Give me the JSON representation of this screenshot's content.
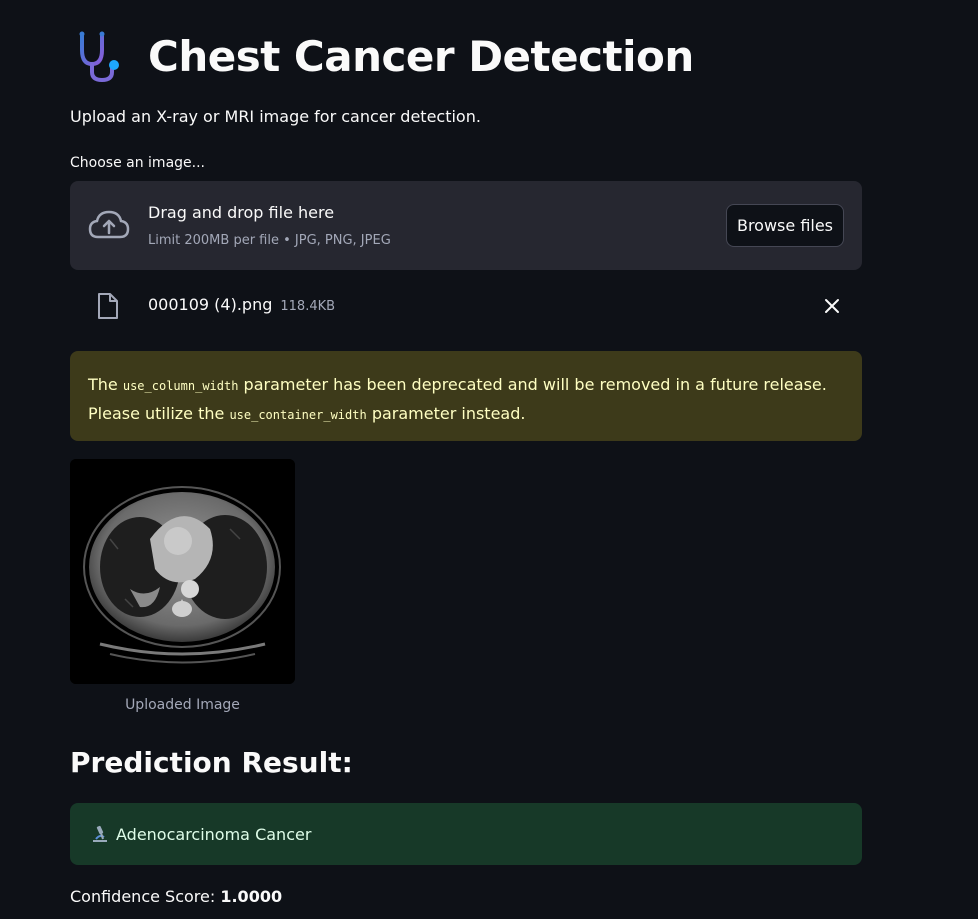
{
  "header": {
    "title": "Chest Cancer Detection",
    "icon": "stethoscope-icon",
    "subtitle": "Upload an X-ray or MRI image for cancer detection."
  },
  "uploader": {
    "label": "Choose an image...",
    "drop_text": "Drag and drop file here",
    "limit_text": "Limit 200MB per file • JPG, PNG, JPEG",
    "browse_label": "Browse files",
    "icon": "cloud-upload-icon"
  },
  "file": {
    "name": "000109 (4).png",
    "size": "118.4KB",
    "icon": "file-icon",
    "remove_icon": "close-icon"
  },
  "warning": {
    "prefix": "The",
    "code1": "use_column_width",
    "middle": "parameter has been deprecated and will be removed in a future release. Please utilize the",
    "code2": "use_container_width",
    "suffix": "parameter instead.",
    "bg_color": "#3d3a1a",
    "text_color": "#ffffc2"
  },
  "image": {
    "caption": "Uploaded Image"
  },
  "result": {
    "heading": "Prediction Result:",
    "prediction": "Adenocarcinoma Cancer",
    "icon": "microscope-icon",
    "bg_color": "#173928",
    "confidence_label": "Confidence Score:",
    "confidence_value": "1.0000"
  },
  "theme": {
    "background": "#0e1117",
    "panel": "#262730",
    "accent": "#1c83e1"
  }
}
